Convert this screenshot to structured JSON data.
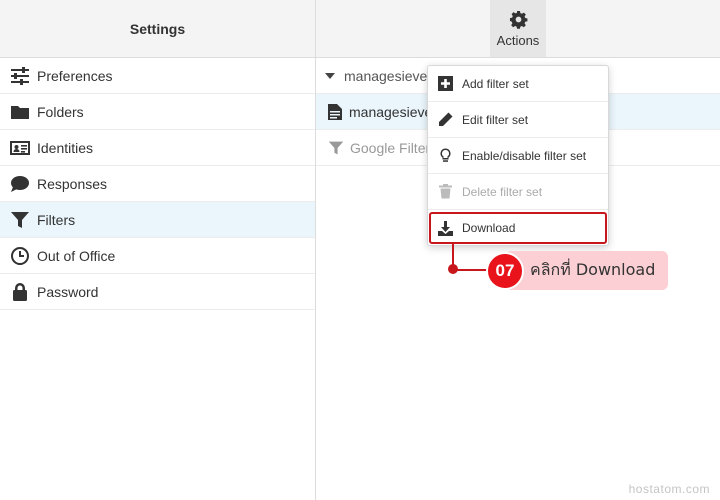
{
  "left": {
    "header": "Settings",
    "items": [
      {
        "label": "Preferences",
        "icon": "sliders-icon"
      },
      {
        "label": "Folders",
        "icon": "folder-icon"
      },
      {
        "label": "Identities",
        "icon": "id-card-icon"
      },
      {
        "label": "Responses",
        "icon": "comment-icon"
      },
      {
        "label": "Filters",
        "icon": "filter-icon",
        "selected": true
      },
      {
        "label": "Out of Office",
        "icon": "clock-icon"
      },
      {
        "label": "Password",
        "icon": "lock-icon"
      }
    ]
  },
  "toolbar": {
    "actions_label": "Actions",
    "actions_icon": "gear-icon"
  },
  "right": {
    "set_name": "managesieve",
    "script_name": "managesieve",
    "filter_name": "Google Filter"
  },
  "menu": {
    "items": [
      {
        "label": "Add filter set",
        "icon": "plus-square-icon",
        "enabled": true
      },
      {
        "label": "Edit filter set",
        "icon": "pencil-icon",
        "enabled": true
      },
      {
        "label": "Enable/disable filter set",
        "icon": "lightbulb-icon",
        "enabled": true
      },
      {
        "label": "Delete filter set",
        "icon": "trash-icon",
        "enabled": false
      },
      {
        "label": "Download",
        "icon": "download-icon",
        "enabled": true,
        "highlighted": true
      }
    ]
  },
  "callout": {
    "step": "07",
    "text": "คลิกที่ Download",
    "color": "#e8131b"
  },
  "watermark": "hostatom.com"
}
